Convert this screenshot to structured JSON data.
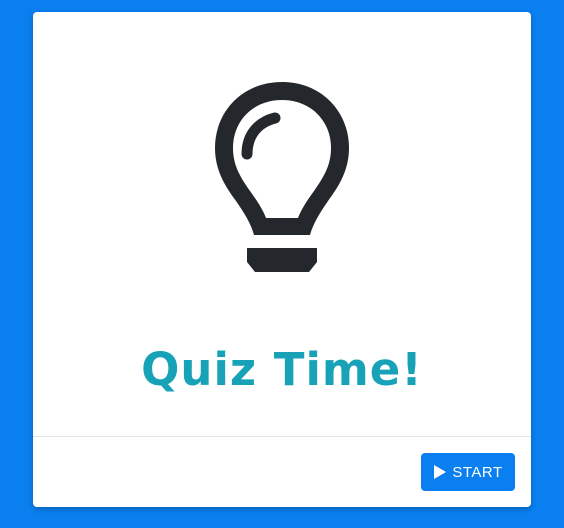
{
  "page": {
    "background_color": "#0a7ff0"
  },
  "card": {
    "icon": "lightbulb-icon",
    "title": "Quiz Time!",
    "title_color": "#17a2b8"
  },
  "footer": {
    "start_button": {
      "icon": "play-icon",
      "label": "START",
      "color": "#0a7ff0"
    }
  }
}
